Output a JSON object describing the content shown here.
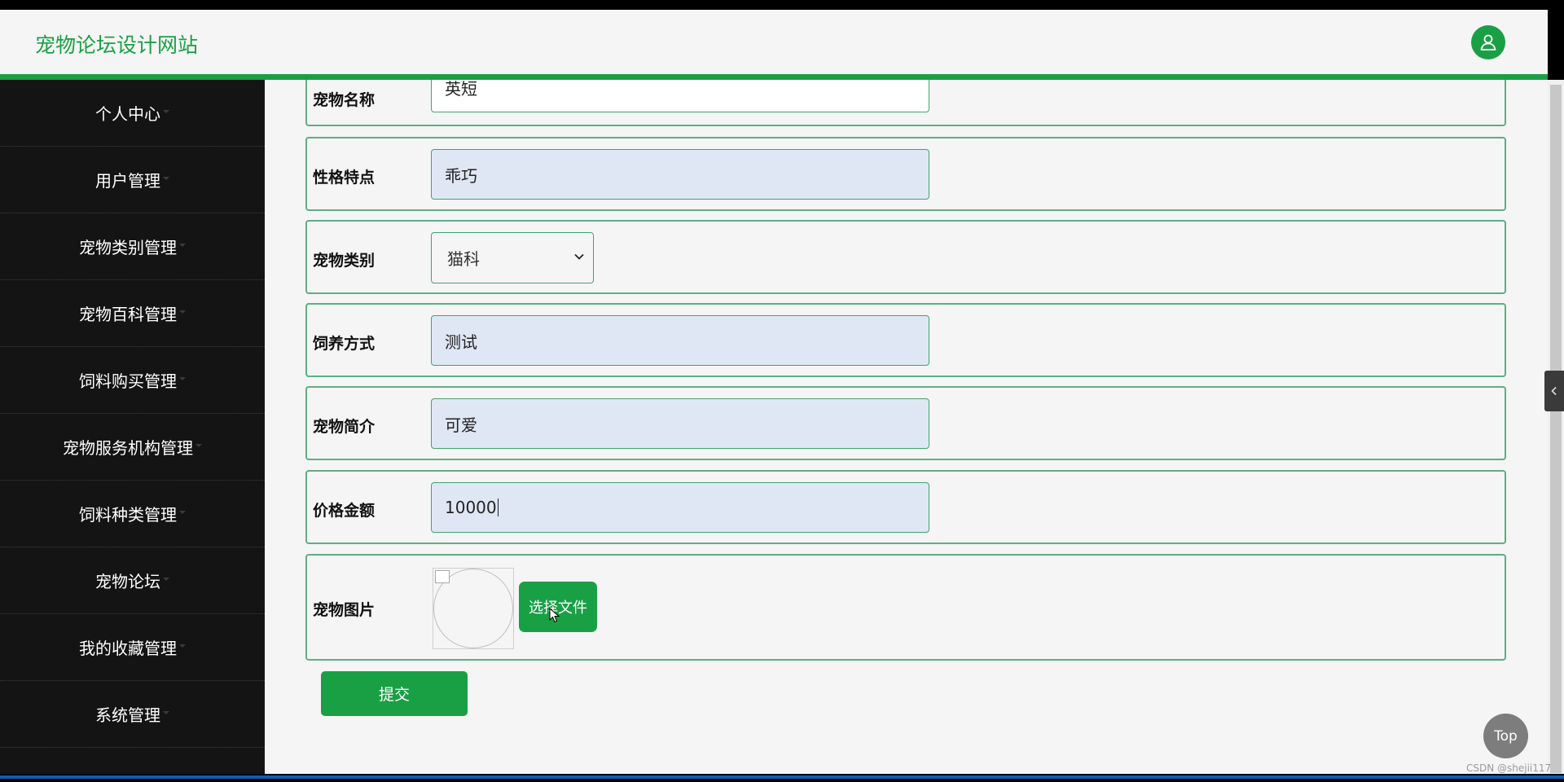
{
  "header": {
    "site_title": "宠物论坛设计网站",
    "avatar_icon": "user-icon"
  },
  "sidebar": {
    "items": [
      {
        "label": "个人中心"
      },
      {
        "label": "用户管理"
      },
      {
        "label": "宠物类别管理"
      },
      {
        "label": "宠物百科管理"
      },
      {
        "label": "饲料购买管理"
      },
      {
        "label": "宠物服务机构管理"
      },
      {
        "label": "饲料种类管理"
      },
      {
        "label": "宠物论坛"
      },
      {
        "label": "我的收藏管理"
      },
      {
        "label": "系统管理"
      }
    ]
  },
  "form": {
    "pet_name": {
      "label": "宠物名称",
      "value": "英短"
    },
    "personality": {
      "label": "性格特点",
      "value": "乖巧"
    },
    "category": {
      "label": "宠物类别",
      "selected": "猫科"
    },
    "feeding": {
      "label": "饲养方式",
      "value": "测试"
    },
    "intro": {
      "label": "宠物简介",
      "value": "可爱"
    },
    "price": {
      "label": "价格金额",
      "value": "10000"
    },
    "image": {
      "label": "宠物图片",
      "button": "选择文件"
    },
    "submit": "提交"
  },
  "top_button": "Top",
  "watermark": "CSDN @shejii117",
  "colors": {
    "accent": "#19a045",
    "sidebar_bg": "#141414",
    "input_bg": "#dfe7f5"
  }
}
